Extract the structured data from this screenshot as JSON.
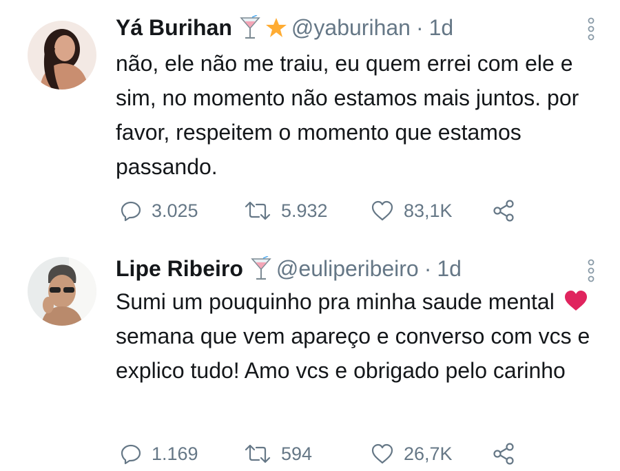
{
  "tweets": [
    {
      "name": "Yá Burihan",
      "handle": "@yaburihan",
      "separator": "·",
      "time": "1d",
      "text": "não, ele não me traiu, eu quem errei com ele e sim, no momento não estamos mais juntos. por favor, respeitem o momento que estamos passando.",
      "replies": "3.025",
      "retweets": "5.932",
      "likes": "83,1K",
      "badges": [
        "cocktail-emoji",
        "star-emoji"
      ]
    },
    {
      "name": "Lipe Ribeiro",
      "handle": "@euliperibeiro",
      "separator": "·",
      "time": "1d",
      "text_before": "Sumi um pouquinho pra minha saude mental",
      "text_after": "semana que vem apareço e converso com vcs e explico tudo! Amo vcs e obrigado pelo carinho",
      "replies": "1.169",
      "retweets": "594",
      "likes": "26,7K",
      "badges": [
        "cocktail-emoji"
      ]
    }
  ],
  "colors": {
    "text": "#14171a",
    "secondary": "#657786",
    "heart": "#e0245e",
    "star": "#ffac33"
  }
}
